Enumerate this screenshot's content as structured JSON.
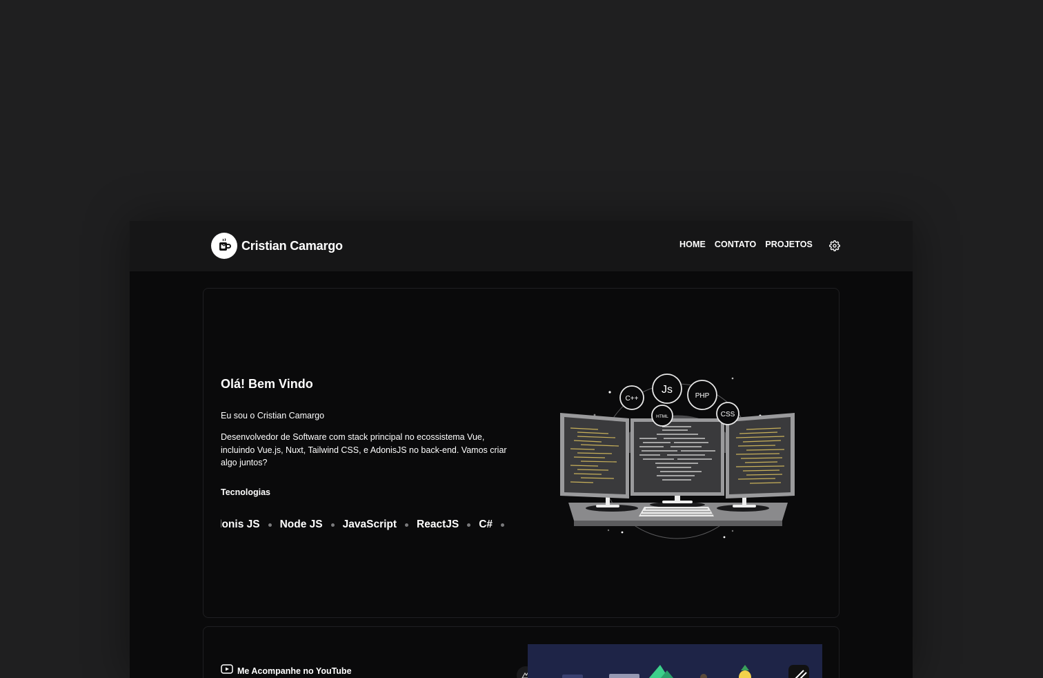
{
  "brand": {
    "name": "Cristian Camargo",
    "logo_icon": "mug-icon"
  },
  "nav": {
    "items": [
      {
        "label": "HOME"
      },
      {
        "label": "CONTATO"
      },
      {
        "label": "PROJETOS"
      }
    ],
    "settings_icon": "gear-icon"
  },
  "hero": {
    "title": "Olá! Bem Vindo",
    "intro": "Eu sou o Cristian Camargo",
    "description": "Desenvolvedor de Software com stack principal no ecossistema Vue, incluindo Vue.js, Nuxt, Tailwind CSS, e AdonisJS no back-end. Vamos criar algo juntos?",
    "technologies_title": "Tecnologias",
    "technologies": [
      "donis JS",
      "Node JS",
      "JavaScript",
      "ReactJS",
      "C#"
    ],
    "illustration": {
      "bubbles": [
        "C++",
        "Js",
        "PHP",
        "HTML",
        "CSS"
      ]
    }
  },
  "youtube": {
    "label": "Me Acompanhe no YouTube",
    "icon": "youtube-icon"
  },
  "colors": {
    "page_bg": "#1f1f20",
    "navbar_bg": "#161617",
    "content_bg": "#0a0a0b",
    "thumbnail_bg": "#1e2447",
    "code_yellow": "#c9b15a"
  }
}
